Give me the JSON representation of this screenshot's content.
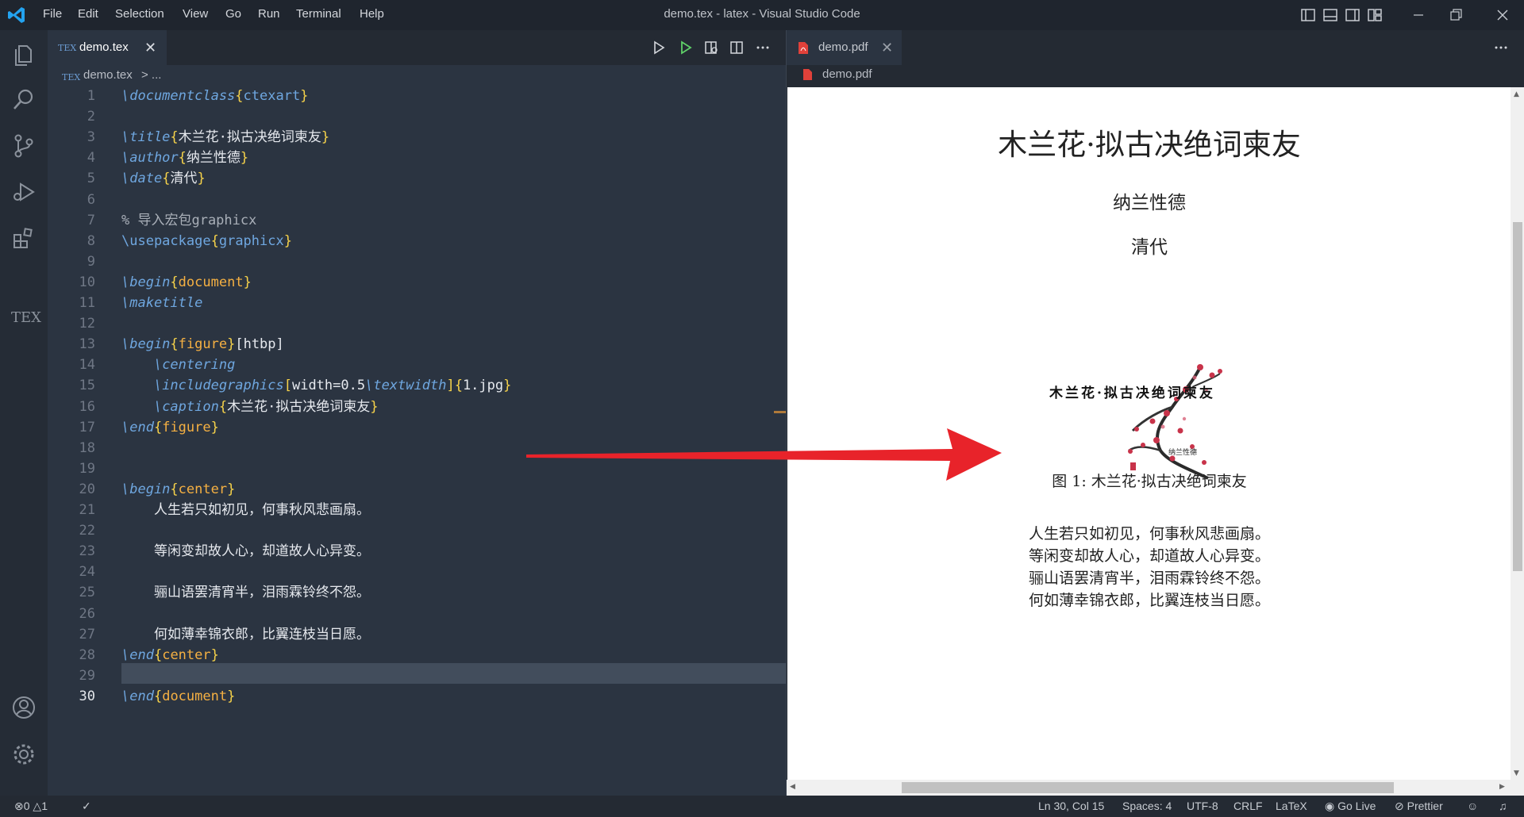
{
  "window": {
    "title": "demo.tex - latex - Visual Studio Code"
  },
  "menu": [
    "File",
    "Edit",
    "Selection",
    "View",
    "Go",
    "Run",
    "Terminal",
    "Help"
  ],
  "activity": {
    "tex_label": "TEX"
  },
  "left_editor": {
    "tab": {
      "icon_text": "TEX",
      "label": "demo.tex",
      "close": "✕"
    },
    "breadcrumb": {
      "file": "demo.tex",
      "rest": "> ..."
    },
    "active_line": "30",
    "lines": [
      {
        "n": "1",
        "parts": [
          [
            "cmd",
            "\\documentclass"
          ],
          [
            "br",
            "{"
          ],
          [
            "argb",
            "ctexart"
          ],
          [
            "br",
            "}"
          ]
        ]
      },
      {
        "n": "2",
        "parts": []
      },
      {
        "n": "3",
        "parts": [
          [
            "cmd",
            "\\title"
          ],
          [
            "br",
            "{"
          ],
          [
            "plain",
            "木兰花·拟古决绝词柬友"
          ],
          [
            "br",
            "}"
          ]
        ]
      },
      {
        "n": "4",
        "parts": [
          [
            "cmd",
            "\\author"
          ],
          [
            "br",
            "{"
          ],
          [
            "plain",
            "纳兰性德"
          ],
          [
            "br",
            "}"
          ]
        ]
      },
      {
        "n": "5",
        "parts": [
          [
            "cmd",
            "\\date"
          ],
          [
            "br",
            "{"
          ],
          [
            "plain",
            "清代"
          ],
          [
            "br",
            "}"
          ]
        ]
      },
      {
        "n": "6",
        "parts": []
      },
      {
        "n": "7",
        "parts": [
          [
            "cmt",
            "% 导入宏包graphicx"
          ]
        ]
      },
      {
        "n": "8",
        "parts": [
          [
            "cmdn",
            "\\usepackage"
          ],
          [
            "br",
            "{"
          ],
          [
            "argb",
            "graphicx"
          ],
          [
            "br",
            "}"
          ]
        ]
      },
      {
        "n": "9",
        "parts": []
      },
      {
        "n": "10",
        "parts": [
          [
            "cmd",
            "\\begin"
          ],
          [
            "br",
            "{"
          ],
          [
            "arg",
            "document"
          ],
          [
            "br",
            "}"
          ]
        ]
      },
      {
        "n": "11",
        "parts": [
          [
            "cmd",
            "\\maketitle"
          ]
        ]
      },
      {
        "n": "12",
        "parts": []
      },
      {
        "n": "13",
        "parts": [
          [
            "cmd",
            "\\begin"
          ],
          [
            "br",
            "{"
          ],
          [
            "arg",
            "figure"
          ],
          [
            "br",
            "}"
          ],
          [
            "plain",
            "[htbp]"
          ]
        ]
      },
      {
        "n": "14",
        "parts": [
          [
            "plain",
            "    "
          ],
          [
            "cmd",
            "\\centering"
          ]
        ]
      },
      {
        "n": "15",
        "parts": [
          [
            "plain",
            "    "
          ],
          [
            "cmd",
            "\\includegraphics"
          ],
          [
            "br",
            "["
          ],
          [
            "plain",
            "width=0.5"
          ],
          [
            "cmd",
            "\\textwidth"
          ],
          [
            "br",
            "]{"
          ],
          [
            "plain",
            "1.jpg"
          ],
          [
            "br",
            "}"
          ]
        ]
      },
      {
        "n": "16",
        "parts": [
          [
            "plain",
            "    "
          ],
          [
            "cmd",
            "\\caption"
          ],
          [
            "br",
            "{"
          ],
          [
            "plain",
            "木兰花·拟古决绝词柬友"
          ],
          [
            "br",
            "}"
          ]
        ]
      },
      {
        "n": "17",
        "parts": [
          [
            "cmd",
            "\\end"
          ],
          [
            "br",
            "{"
          ],
          [
            "arg",
            "figure"
          ],
          [
            "br",
            "}"
          ]
        ]
      },
      {
        "n": "18",
        "parts": []
      },
      {
        "n": "19",
        "parts": []
      },
      {
        "n": "20",
        "parts": [
          [
            "cmd",
            "\\begin"
          ],
          [
            "br",
            "{"
          ],
          [
            "arg",
            "center"
          ],
          [
            "br",
            "}"
          ]
        ]
      },
      {
        "n": "21",
        "parts": [
          [
            "plain",
            "    人生若只如初见，何事秋风悲画扇。"
          ]
        ]
      },
      {
        "n": "22",
        "parts": []
      },
      {
        "n": "23",
        "parts": [
          [
            "plain",
            "    等闲变却故人心，却道故人心异变。"
          ]
        ]
      },
      {
        "n": "24",
        "parts": []
      },
      {
        "n": "25",
        "parts": [
          [
            "plain",
            "    骊山语罢清宵半，泪雨霖铃终不怨。"
          ]
        ]
      },
      {
        "n": "26",
        "parts": []
      },
      {
        "n": "27",
        "parts": [
          [
            "plain",
            "    何如薄幸锦衣郎，比翼连枝当日愿。"
          ]
        ]
      },
      {
        "n": "28",
        "parts": [
          [
            "cmd",
            "\\end"
          ],
          [
            "br",
            "{"
          ],
          [
            "arg",
            "center"
          ],
          [
            "br",
            "}"
          ]
        ]
      },
      {
        "n": "29",
        "parts": []
      },
      {
        "n": "30",
        "parts": [
          [
            "cmd",
            "\\end"
          ],
          [
            "br",
            "{"
          ],
          [
            "arg",
            "document"
          ],
          [
            "br",
            "}"
          ]
        ]
      }
    ]
  },
  "right_editor": {
    "tab": {
      "label": "demo.pdf",
      "close": "✕"
    },
    "breadcrumb": "demo.pdf",
    "pdf": {
      "title": "木兰花·拟古决绝词柬友",
      "author": "纳兰性德",
      "date": "清代",
      "figure_calligraphy": "木兰花·拟古决绝词柬友",
      "figure_signature": "纳兰性德",
      "caption": "图 1: 木兰花·拟古决绝词柬友",
      "poem": [
        "人生若只如初见，何事秋风悲画扇。",
        "等闲变却故人心，却道故人心异变。",
        "骊山语罢清宵半，泪雨霖铃终不怨。",
        "何如薄幸锦衣郎，比翼连枝当日愿。"
      ]
    }
  },
  "status": {
    "errors": "0",
    "warnings": "1",
    "position": "Ln 30, Col 15",
    "spaces": "Spaces: 4",
    "encoding": "UTF-8",
    "eol": "CRLF",
    "language": "LaTeX",
    "golive": "Go Live",
    "prettier": "Prettier"
  },
  "colors": {
    "accent": "#23a3f0",
    "arrow": "#e8232a",
    "command": "#6fa7e0",
    "brace": "#f7d34a",
    "argument": "#f5b042"
  }
}
